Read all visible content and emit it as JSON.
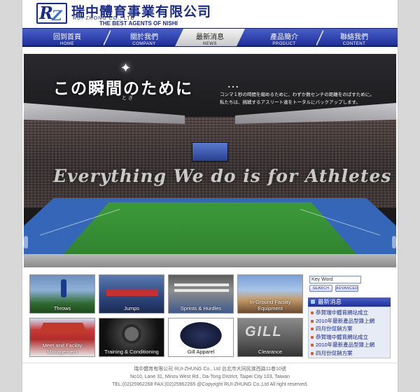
{
  "brand": {
    "name_cn": "瑞中體育事業有限公司",
    "name_en": "RUI-ZHONG CO., LTD",
    "tagline": "THE BEST AGENTS OF NISHI",
    "logo_letters": "RZ"
  },
  "nav": {
    "items": [
      {
        "zh": "回到首頁",
        "en": "HOME"
      },
      {
        "zh": "關於我們",
        "en": "COMPANY"
      },
      {
        "zh": "最新消息",
        "en": "NEWS"
      },
      {
        "zh": "產品簡介",
        "en": "PRODUCT"
      },
      {
        "zh": "聯絡我們",
        "en": "CONTENT"
      }
    ],
    "active_index": 2
  },
  "hero": {
    "headline": "この瞬間のために",
    "headline_dots": "…",
    "ruby": "と き",
    "subtext_line1": "コンマ１秒の時間を縮めるために、わずか数センチの距離をのばすために。",
    "subtext_line2": "私たちは、挑戦するアスリート達をトータルにバックアップします。",
    "tagline": "Everything We do is for Athletes"
  },
  "tiles": [
    {
      "label": "Throws"
    },
    {
      "label": "Jumps"
    },
    {
      "label": "Sprints & Hurdles"
    },
    {
      "label": "In-Ground Facility Equipment"
    },
    {
      "label": "Meet and Facility Management"
    },
    {
      "label": "Training & Conditioning"
    },
    {
      "label": "Gill Apparel"
    },
    {
      "label": "Clearance"
    }
  ],
  "search": {
    "keyword_value": "Key Word",
    "search_label": "SEARCH",
    "advanced_label": "ADVANCED"
  },
  "news": {
    "heading": "最新消息",
    "items": [
      "恭賀瑞中體育網站成立",
      "2010年最新產品型錄上網",
      "四月份促銷方案",
      "恭賀瑞中體育網站成立",
      "2010年最新產品型錄上網",
      "四月份促銷方案"
    ]
  },
  "footer": {
    "line1": "瑞中體育有限公司  RUI-ZHUNG Co., Ltd 台北市大同民族西路11巷10號",
    "line2": "No10, Lane 31, Minzu West Rd., Da-Tong District, Taipei City 103, Taiwan",
    "line3": "TEL:(02)25962268  FAX:(02)25962265 @Copyright RUI-ZHUNG Co.,Ltd All right reserved."
  }
}
